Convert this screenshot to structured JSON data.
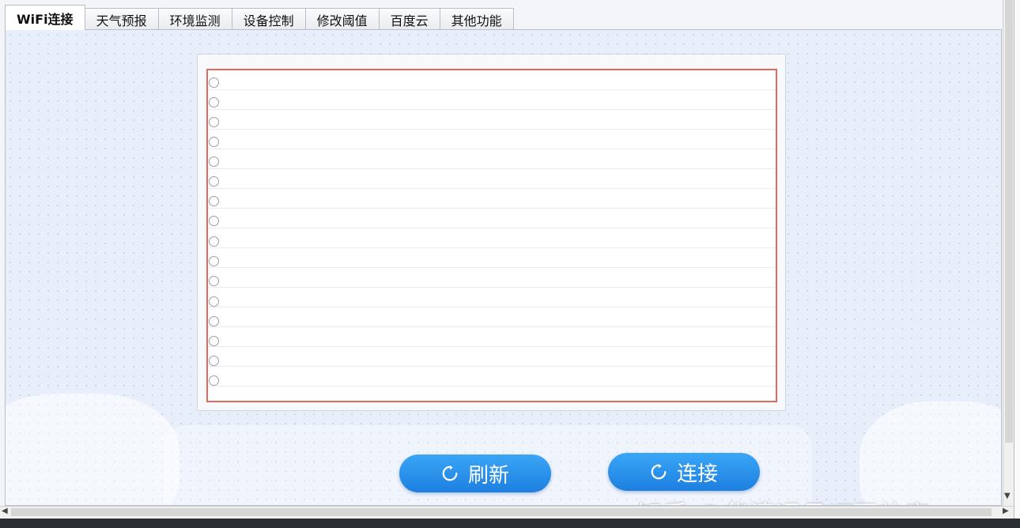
{
  "tabs": [
    {
      "label": "WiFi连接",
      "active": true
    },
    {
      "label": "天气预报",
      "active": false
    },
    {
      "label": "环境监测",
      "active": false
    },
    {
      "label": "设备控制",
      "active": false
    },
    {
      "label": "修改阈值",
      "active": false
    },
    {
      "label": "百度云",
      "active": false
    },
    {
      "label": "其他功能",
      "active": false
    }
  ],
  "wifi_list": {
    "items": []
  },
  "buttons": {
    "refresh_label": "刷新",
    "refresh_icon": "refresh-icon",
    "connect_label": "连接",
    "connect_icon": "refresh-icon"
  },
  "watermark": "知乎 @华清远见IT开放实...",
  "colors": {
    "accent": "#2b8ff0",
    "notebook_border": "#e06a5d",
    "panel_bg": "#e9effa"
  }
}
